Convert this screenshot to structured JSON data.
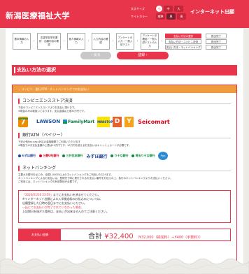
{
  "header": {
    "logo": "新潟医療福祉大学",
    "tools": {
      "size_label": "文字サイズ",
      "size_small": "小",
      "size_medium": "中",
      "size_large": "大",
      "color_label": "サイトカラー",
      "color_normal": "標準",
      "color_black": "黒",
      "color_blue": "青"
    },
    "title": "インターネット出願"
  },
  "steps": {
    "items": [
      "基本情報の入力",
      "志望学部学科選択・出願内容の確認",
      "個人情報の入力",
      "入力内容の確認",
      "アンケートの入力・一般入試テスト",
      "アンケートの確認・一般入試テストの入力"
    ],
    "sub_items": [
      "支払い方法の選択",
      "支払い方法・コンビニ決済",
      "支払い方法・ネットバンキング"
    ],
    "final_items": [
      "提出完了",
      "提出完了",
      "提出完了"
    ]
  },
  "nav": {
    "back_label": "戻る",
    "next_label": "登録"
  },
  "section_title": "支払い方法の選択",
  "panel_head": "コンビニ・銀行ATM・ネットバンキングでのお支払い",
  "conv": {
    "title": "コンビニエンスストア決済",
    "desc1": "下記のコンビニエンスストアよりお支払い頂けます。",
    "desc2": "※現金のみの取扱いとなります。支払金額は上限30万円です。",
    "logos": {
      "seven": "7",
      "lawson": "LAWSON",
      "famima": "FamilyMart",
      "ministop": "MINISTOP",
      "daily": "D",
      "yamazaki": "Y",
      "seico": "Seicomart"
    }
  },
  "atm": {
    "title": "銀行ATM（ペイジー）",
    "desc1": "下記の他Pay-easy対応の金融機関でご利用いただけます",
    "desc2": "※現金でのお支払金額の上限は10万円です。10万円を超えるお支払いはキャッシュカードが必要です。",
    "banks": [
      "みずほ銀行",
      "三菱UFJ銀行",
      "三井住友銀行",
      "みずほ銀行",
      "りそな銀行",
      "埼玉りそな銀行"
    ],
    "payeasy": "Pay-easy"
  },
  "net": {
    "title": "ネットバンキング",
    "desc1": "主要大手銀行をはじめ、全国1,000行以上のネットバンキングをご利用いただけます。",
    "desc2": "ネットバンキングによるお支払いは、登録完了時に発行されるお支払い番号をお控えの上、各行のネットバンキングよりお支払いください。",
    "desc3": "ご利用には、ネットバンキングの利用契約が必要です。"
  },
  "deadline": {
    "date": "「2020/01/16 23:59」",
    "line1": "までにお支払いを済ませてください。",
    "line2": "※インターネット出願による入学検定料のお払込みについては、",
    "line3": "出願登録した日時の翌日までにお支払いください。",
    "line4": "一括にてお支払いが完了されていなかった場合、",
    "line5": "上記期日を過ぎた場合は、支払いが出来ませんのでご注意ください。"
  },
  "total": {
    "label": "お支払い金額",
    "prefix": "合計",
    "amount": "¥32,400",
    "breakdown": "（¥32,000（検定料）＋¥400（手数料））"
  },
  "colors": {
    "brand": "#e8354b",
    "accent": "#f19a3e"
  }
}
